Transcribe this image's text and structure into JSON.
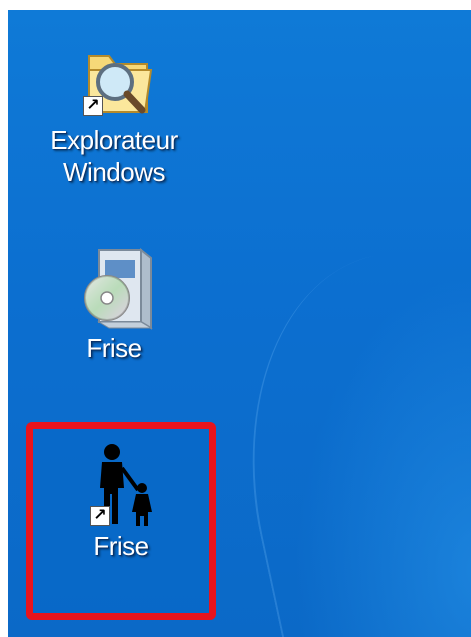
{
  "desktop": {
    "icons": [
      {
        "label_line1": "Explorateur",
        "label_line2": "Windows",
        "icon": "folder-search-icon",
        "shortcut": true
      },
      {
        "label": "Frise",
        "icon": "software-box-cd-icon",
        "shortcut": false
      },
      {
        "label": "Frise",
        "icon": "parent-child-icon",
        "shortcut": true,
        "selected": true
      }
    ],
    "colors": {
      "desktop_blue": "#0c6fd0",
      "highlight_red": "#e8141d"
    }
  }
}
